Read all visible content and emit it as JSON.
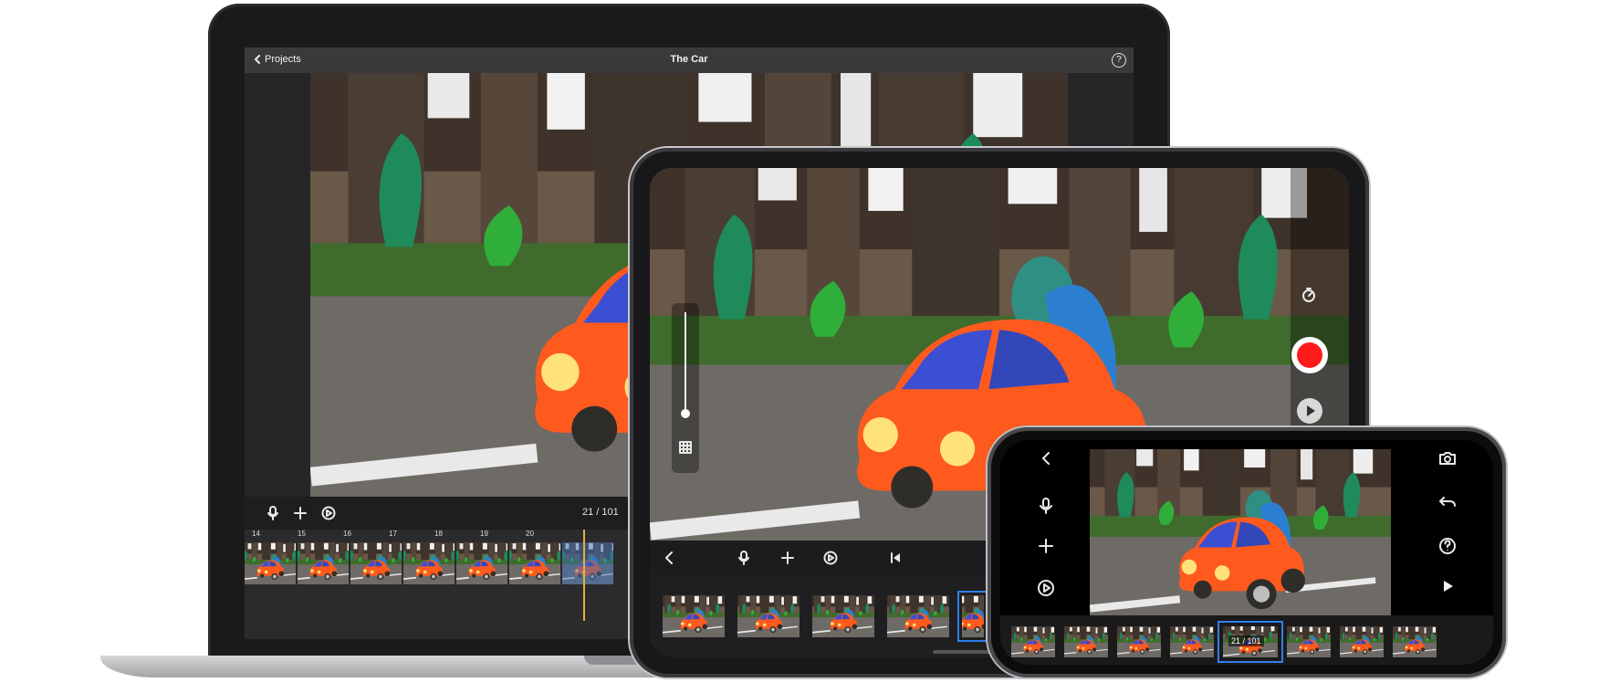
{
  "laptop": {
    "back_label": "Projects",
    "project_title": "The Car",
    "help_glyph": "?",
    "frame_counter": "21 / 101",
    "ruler_ticks": [
      "14",
      "15",
      "16",
      "17",
      "18",
      "19",
      "20"
    ]
  },
  "tablet": {
    "frame_count_visible": 5
  },
  "phone": {
    "frame_counter": "21 / 101"
  },
  "icons": {
    "back": "chevron-left-icon",
    "microphone": "microphone-icon",
    "add": "plus-icon",
    "effects": "play-circle-icon",
    "skip": "skip-back-icon",
    "grid": "grid-icon",
    "timer": "timer-icon",
    "record": "record-icon",
    "play": "play-icon",
    "camera": "camera-icon",
    "undo": "undo-icon",
    "help": "help-icon"
  },
  "colors": {
    "record_red": "#ff1a1a",
    "selection_blue": "#2f7ff0",
    "playhead": "#e5b13a"
  }
}
